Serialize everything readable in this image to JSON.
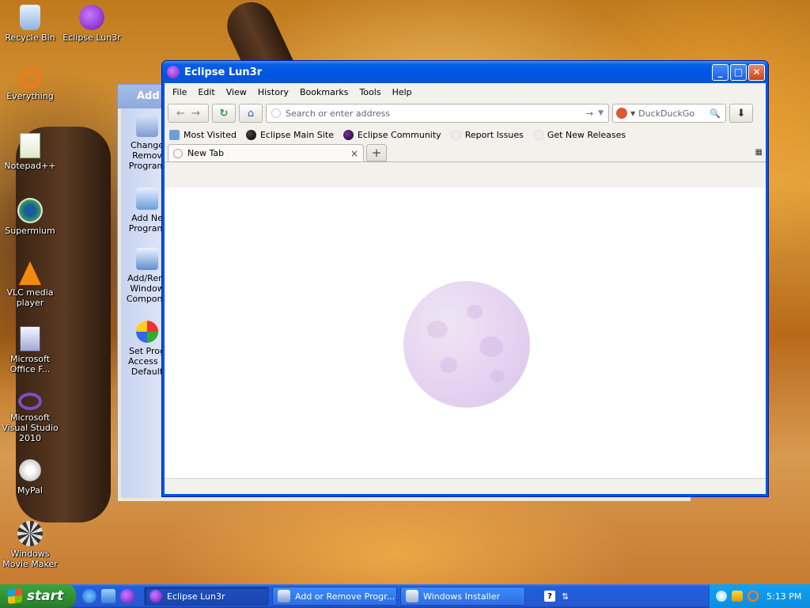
{
  "desktop": {
    "icons": [
      {
        "label": "Recycle Bin",
        "icon": "recycle-bin-icon"
      },
      {
        "label": "Eclipse Lun3r",
        "icon": "eclipse-lun3r-icon"
      },
      {
        "label": "Everything",
        "icon": "everything-icon"
      },
      {
        "label": "Notepad++",
        "icon": "notepad-plus-plus-icon"
      },
      {
        "label": "Supermium",
        "icon": "supermium-icon"
      },
      {
        "label": "VLC media player",
        "icon": "vlc-icon"
      },
      {
        "label": "Microsoft Office F...",
        "icon": "office-icon"
      },
      {
        "label": "Microsoft Visual Studio 2010",
        "icon": "visual-studio-icon"
      },
      {
        "label": "MyPal",
        "icon": "mypal-icon"
      },
      {
        "label": "Windows Movie Maker",
        "icon": "movie-maker-icon"
      }
    ]
  },
  "background_window": {
    "title": "Add o",
    "sidebar": [
      {
        "label": "Change\nRemov\nProgram"
      },
      {
        "label": "Add Ne\nProgram"
      },
      {
        "label": "Add/Rem\nWindow\nCompone"
      },
      {
        "label": "Set Prog\nAccess a\nDefault"
      }
    ]
  },
  "browser": {
    "title": "Eclipse Lun3r",
    "title_buttons": {
      "minimize": "_",
      "maximize": "□",
      "close": "✕"
    },
    "menu": [
      "File",
      "Edit",
      "View",
      "History",
      "Bookmarks",
      "Tools",
      "Help"
    ],
    "url_placeholder": "Search or enter address",
    "search_placeholder": "DuckDuckGo",
    "bookmarks": [
      "Most Visited",
      "Eclipse Main Site",
      "Eclipse Community",
      "Report Issues",
      "Get New Releases"
    ],
    "tab": {
      "label": "New Tab",
      "close": "×"
    },
    "new_tab_button": "+"
  },
  "taskbar": {
    "start_label": "start",
    "tasks": [
      {
        "label": "Eclipse Lun3r",
        "active": true
      },
      {
        "label": "Add or Remove Progr...",
        "active": false
      },
      {
        "label": "Windows Installer",
        "active": false
      }
    ],
    "clock": "5:13 PM"
  },
  "colors": {
    "titlebar": "#0054e3",
    "taskbar": "#245edb",
    "start": "#2f8f33",
    "moon": "#e2cff0"
  }
}
